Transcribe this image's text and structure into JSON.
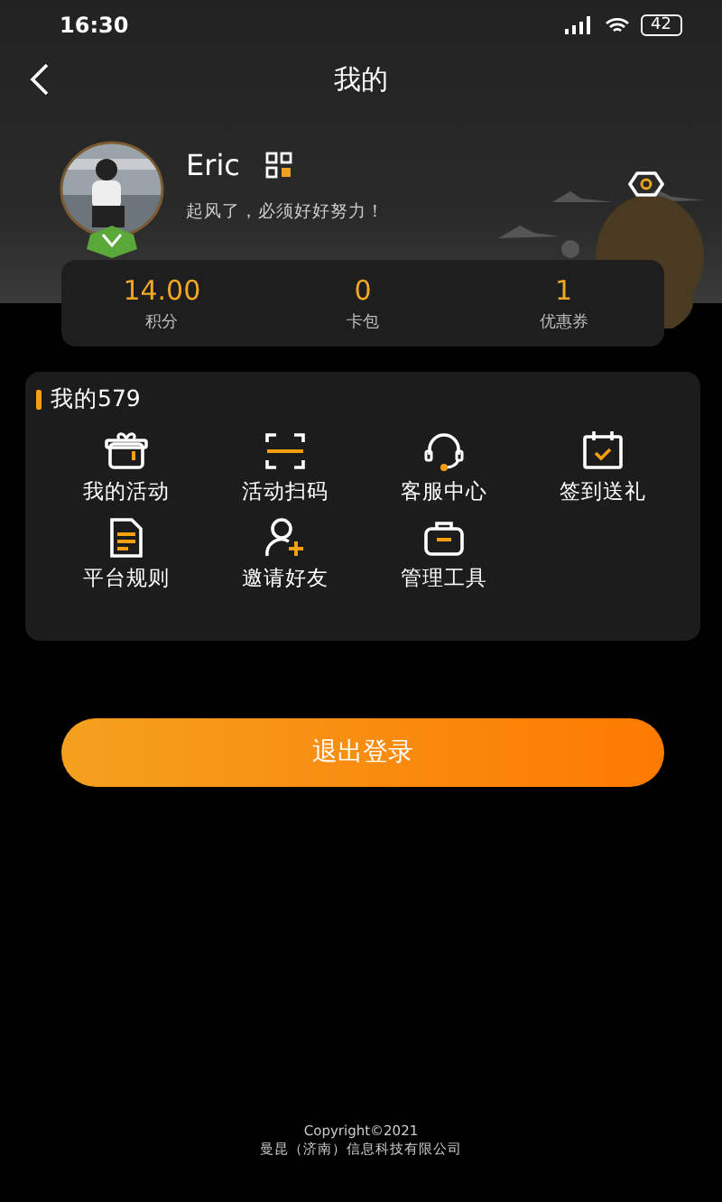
{
  "status_bar": {
    "time": "16:30",
    "battery": "42"
  },
  "nav": {
    "title": "我的"
  },
  "profile": {
    "name": "Eric",
    "motto": "起风了，必须好好努力！"
  },
  "stats": [
    {
      "value": "14.00",
      "label": "积分"
    },
    {
      "value": "0",
      "label": "卡包"
    },
    {
      "value": "1",
      "label": "优惠券"
    }
  ],
  "menu": {
    "title": "我的579",
    "items": [
      {
        "label": "我的活动",
        "kind": "gift"
      },
      {
        "label": "活动扫码",
        "kind": "scan"
      },
      {
        "label": "客服中心",
        "kind": "headset"
      },
      {
        "label": "签到送礼",
        "kind": "calendar"
      },
      {
        "label": "平台规则",
        "kind": "document"
      },
      {
        "label": "邀请好友",
        "kind": "invite"
      },
      {
        "label": "管理工具",
        "kind": "toolbox"
      }
    ]
  },
  "logout_button": "退出登录",
  "footer": [
    "Copyright©2021",
    "曼昆（济南）信息科技有限公司"
  ]
}
